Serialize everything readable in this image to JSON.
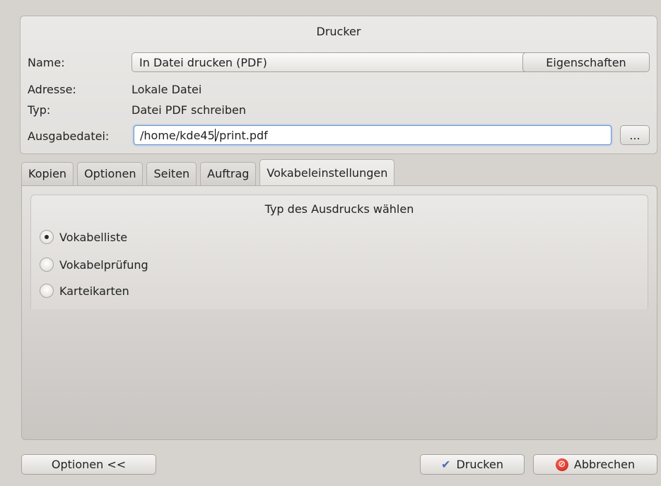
{
  "printer": {
    "group_title": "Drucker",
    "name_label": "Name:",
    "name_value": "In Datei drucken (PDF)",
    "properties_button": "Eigenschaften",
    "address_label": "Adresse:",
    "address_value": "Lokale Datei",
    "type_label": "Typ:",
    "type_value": "Datei PDF schreiben",
    "output_label": "Ausgabedatei:",
    "output_value_before_cursor": "/home/kde45",
    "output_value_after_cursor": "/print.pdf",
    "browse_button": "..."
  },
  "tabs": [
    {
      "label": "Kopien"
    },
    {
      "label": "Optionen"
    },
    {
      "label": "Seiten"
    },
    {
      "label": "Auftrag"
    },
    {
      "label": "Vokabeleinstellungen",
      "active": true
    }
  ],
  "vocab": {
    "group_title": "Typ des Ausdrucks wählen",
    "options": [
      {
        "label": "Vokabelliste",
        "checked": true
      },
      {
        "label": "Vokabelprüfung",
        "checked": false
      },
      {
        "label": "Karteikarten",
        "checked": false
      }
    ]
  },
  "footer": {
    "options_button": "Optionen <<",
    "print_button": "Drucken",
    "cancel_button": "Abbrechen"
  },
  "icons": {
    "print": "checkmark-icon",
    "cancel": "cancel-icon",
    "dropdown": "chevron-down-icon"
  },
  "colors": {
    "focus_border": "#6a95cc",
    "cancel_red": "#c41b14",
    "check_blue": "#4a6fb5"
  }
}
